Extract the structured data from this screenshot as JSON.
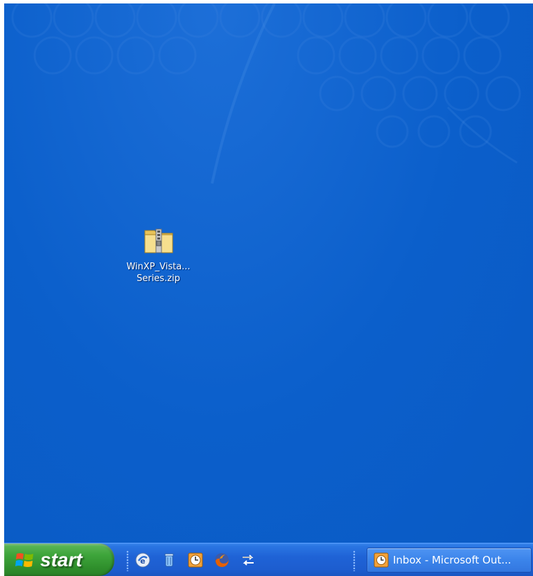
{
  "desktop": {
    "icons": [
      {
        "name": "WinXP_Vista Series.zip",
        "label_line1": "WinXP_Vista...",
        "label_line2": "Series.zip",
        "icon": "zip-folder-icon"
      }
    ]
  },
  "taskbar": {
    "start_label": "start",
    "quick_launch": [
      {
        "icon": "show-desktop-icon"
      },
      {
        "icon": "recycle-bin-icon"
      },
      {
        "icon": "outlook-clock-icon"
      },
      {
        "icon": "firefox-icon"
      },
      {
        "icon": "sync-arrows-icon"
      }
    ],
    "tasks": [
      {
        "label": "Inbox - Microsoft Out...",
        "icon": "outlook-icon"
      }
    ]
  },
  "colors": {
    "desktop": "#0b5fcb",
    "taskbar": "#1f63d6",
    "start_button": "#3ea53b",
    "task_button": "#3b84ea"
  }
}
